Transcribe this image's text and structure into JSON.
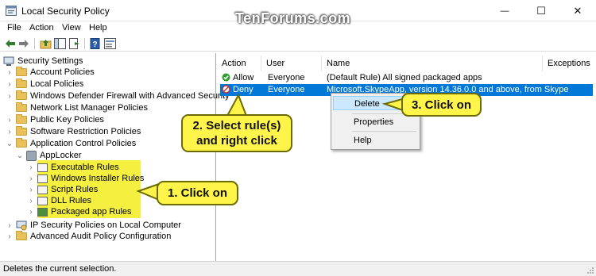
{
  "window": {
    "title": "Local Security Policy",
    "watermark": "TenForums.com",
    "minimize_glyph": "—",
    "maximize_glyph": "☐",
    "close_glyph": "✕"
  },
  "menu": [
    "File",
    "Action",
    "View",
    "Help"
  ],
  "toolbar_icons": [
    "back-icon",
    "forward-icon",
    "up-folder-icon",
    "console-tree-icon",
    "export-list-icon",
    "help-icon",
    "properties-icon"
  ],
  "tree": {
    "root": "Security Settings",
    "items": [
      "Account Policies",
      "Local Policies",
      "Windows Defender Firewall with Advanced Security",
      "Network List Manager Policies",
      "Public Key Policies",
      "Software Restriction Policies",
      "Application Control Policies",
      "AppLocker",
      "Executable Rules",
      "Windows Installer Rules",
      "Script Rules",
      "DLL Rules",
      "Packaged app Rules",
      "IP Security Policies on Local Computer",
      "Advanced Audit Policy Configuration"
    ]
  },
  "list": {
    "columns": [
      "Action",
      "User",
      "Name",
      "Exceptions"
    ],
    "rows": [
      {
        "action": "Allow",
        "user": "Everyone",
        "name": "(Default Rule) All signed packaged apps",
        "exceptions": ""
      },
      {
        "action": "Deny",
        "user": "Everyone",
        "name": "Microsoft.SkypeApp, version 14.36.0.0 and above, from Skype",
        "exceptions": ""
      }
    ]
  },
  "context_menu": [
    "Delete",
    "Properties",
    "Help"
  ],
  "callouts": {
    "click_on_1": "1. Click on",
    "select_line1": "2. Select rule(s)",
    "select_line2": "and right click",
    "click_on_3": "3. Click on"
  },
  "status": "Deletes the current selection.",
  "colors": {
    "selection": "#0078d7",
    "highlight": "#f5f040",
    "callout_fill": "#fff44a",
    "allow_green": "#2e9e2e"
  }
}
